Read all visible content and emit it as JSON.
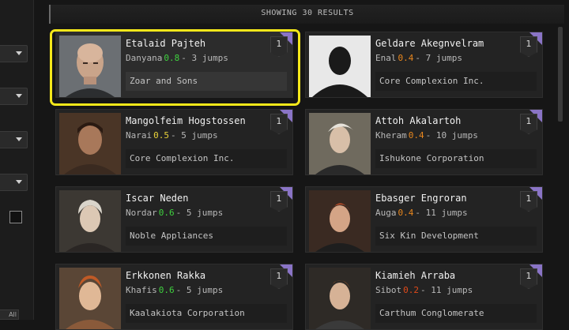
{
  "header": {
    "results_label": "SHOWING 30 RESULTS"
  },
  "sidebar": {
    "all_label": "All"
  },
  "colors": {
    "highlight": "#f5e81a",
    "corner_badge": "#8a74c6",
    "sec_high": "#3fd13f",
    "sec_mid": "#e8d23a",
    "sec_low": "#e8871e",
    "sec_null": "#e04a1a"
  },
  "cards": [
    {
      "name": "Etalaid Pajteh",
      "system": "Danyana",
      "security": "0.8",
      "sec_color": "#3fd13f",
      "jumps": "- 3 jumps",
      "corporation": "Zoar and Sons",
      "count": "1",
      "icon": "bald-male-portrait",
      "selected": true
    },
    {
      "name": "Geldare Akegnvelram",
      "system": "Enal",
      "security": "0.4",
      "sec_color": "#e8871e",
      "jumps": "- 7 jumps",
      "corporation": "Core Complexion Inc.",
      "count": "1",
      "icon": "silhouette-portrait"
    },
    {
      "name": "Mangolfeim Hogstossen",
      "system": "Narai",
      "security": "0.5",
      "sec_color": "#e8d23a",
      "jumps": "- 5 jumps",
      "corporation": "Core Complexion Inc.",
      "count": "1",
      "icon": "male-portrait"
    },
    {
      "name": "Attoh Akalartoh",
      "system": "Kheram",
      "security": "0.4",
      "sec_color": "#e8871e",
      "jumps": "- 10 jumps",
      "corporation": "Ishukone Corporation",
      "count": "1",
      "icon": "female-portrait"
    },
    {
      "name": "Iscar Neden",
      "system": "Nordar",
      "security": "0.6",
      "sec_color": "#3fd13f",
      "jumps": "- 5 jumps",
      "corporation": "Noble Appliances",
      "count": "1",
      "icon": "female-portrait"
    },
    {
      "name": "Ebasger Engroran",
      "system": "Auga",
      "security": "0.4",
      "sec_color": "#e8871e",
      "jumps": "- 11 jumps",
      "corporation": "Six Kin Development",
      "count": "1",
      "icon": "female-portrait"
    },
    {
      "name": "Erkkonen Rakka",
      "system": "Khafis",
      "security": "0.6",
      "sec_color": "#3fd13f",
      "jumps": "- 5 jumps",
      "corporation": "Kaalakiota Corporation",
      "count": "1",
      "icon": "male-portrait"
    },
    {
      "name": "Kiamieh Arraba",
      "system": "Sibot",
      "security": "0.2",
      "sec_color": "#e04a1a",
      "jumps": "- 11 jumps",
      "corporation": "Carthum Conglomerate",
      "count": "1",
      "icon": "female-portrait"
    }
  ]
}
